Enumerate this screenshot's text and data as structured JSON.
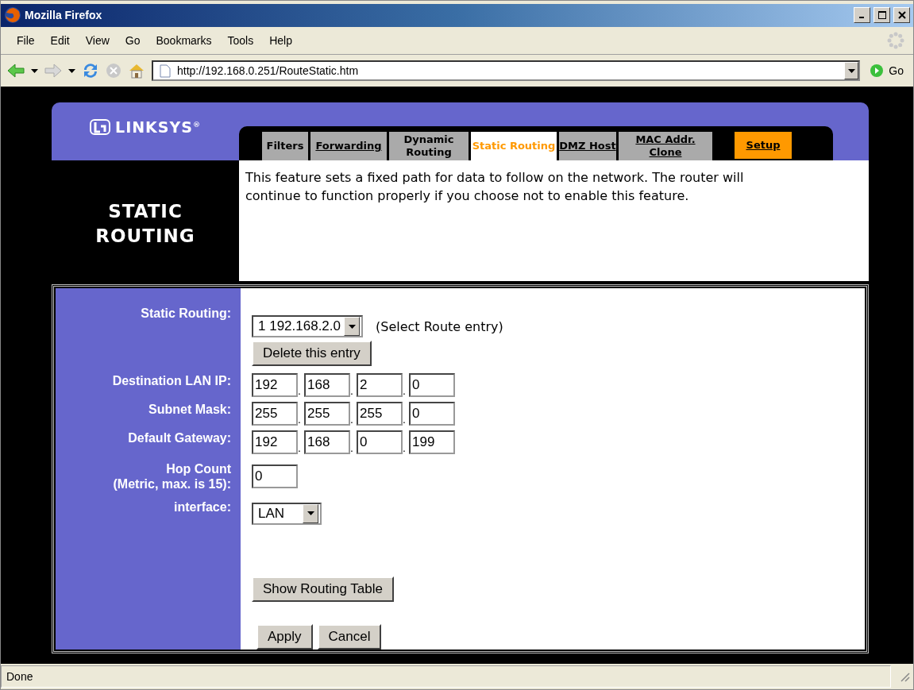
{
  "window": {
    "title": "Mozilla Firefox"
  },
  "menu": [
    "File",
    "Edit",
    "View",
    "Go",
    "Bookmarks",
    "Tools",
    "Help"
  ],
  "toolbar": {
    "back_disabled": false,
    "forward_disabled": true,
    "stop_disabled": true,
    "address": "http://192.168.0.251/RouteStatic.htm",
    "go": "Go"
  },
  "brand": {
    "name": "LINKSYS",
    "mark": "®"
  },
  "tabs": [
    {
      "label": "Filters",
      "link": false,
      "selected": false,
      "kind": "tab"
    },
    {
      "label": "Forwarding",
      "link": true,
      "selected": false,
      "kind": "tab"
    },
    {
      "label": "Dynamic Routing",
      "link": false,
      "selected": false,
      "kind": "tab"
    },
    {
      "label": "Static Routing",
      "link": false,
      "selected": true,
      "kind": "tab"
    },
    {
      "label": "DMZ Host",
      "link": true,
      "selected": false,
      "kind": "tab"
    },
    {
      "label": "MAC Addr. Clone",
      "link": true,
      "selected": false,
      "kind": "tab"
    },
    {
      "label": "Setup",
      "link": true,
      "selected": false,
      "kind": "setup"
    }
  ],
  "section_title": "STATIC ROUTING",
  "description": "This feature sets a fixed path for data to follow on the network. The router will continue to function properly if you choose not to enable this feature.",
  "form": [
    {
      "kind": "route",
      "label": "Static Routing:",
      "value": "1 192.168.2.0",
      "hint": "(Select Route entry)",
      "button": "Delete this entry"
    },
    {
      "kind": "ip",
      "label": "Destination LAN IP:",
      "octets": [
        "192",
        "168",
        "2",
        "0"
      ],
      "separators": [
        ".",
        ".",
        "."
      ]
    },
    {
      "kind": "ip",
      "label": "Subnet Mask:",
      "octets": [
        "255",
        "255",
        "255",
        "0"
      ],
      "separators": [
        ".",
        ".",
        "."
      ]
    },
    {
      "kind": "ip",
      "label": "Default Gateway:",
      "octets": [
        "192",
        "168",
        "0",
        "199"
      ],
      "separators": [
        ".",
        ".",
        "."
      ]
    },
    {
      "kind": "text",
      "label": [
        "Hop Count",
        "(Metric, max. is 15):"
      ],
      "value": "0"
    },
    {
      "kind": "select",
      "label": "interface:",
      "value": "LAN"
    }
  ],
  "show_table": "Show Routing Table",
  "actions": [
    "Apply",
    "Cancel"
  ],
  "status_bar": "Done"
}
